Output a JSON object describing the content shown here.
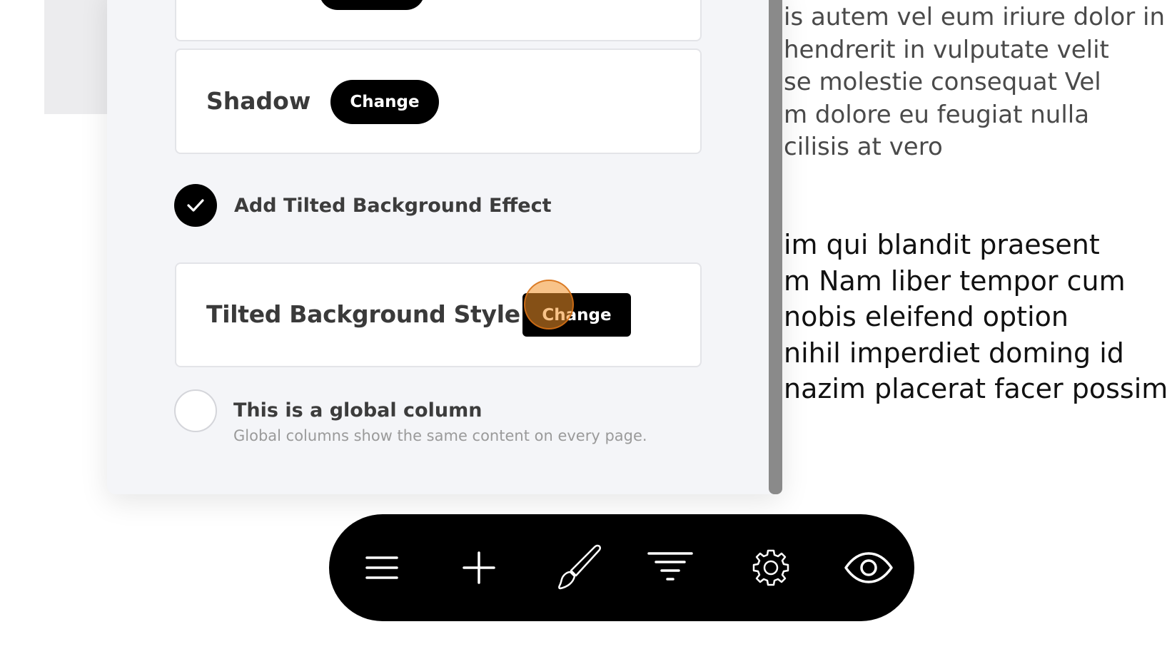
{
  "background_text": {
    "paragraph1": [
      "is autem vel eum iriure dolor in",
      "hendrerit in vulputate velit",
      "se molestie consequat Vel",
      "m dolore eu feugiat nulla",
      "cilisis at vero"
    ],
    "paragraph2": [
      "im qui blandit praesent",
      "m Nam liber tempor cum",
      "nobis eleifend option",
      "nihil imperdiet doming id",
      "nazim placerat facer possim"
    ]
  },
  "panel": {
    "top_card": {
      "button_label": ""
    },
    "shadow_card": {
      "label": "Shadow",
      "button_label": "Change"
    },
    "tilted_checkbox": {
      "label": "Add Tilted Background Effect",
      "checked": true
    },
    "tilted_style_card": {
      "label": "Tilted Background Style",
      "button_label": "Change"
    },
    "global_column": {
      "title": "This is a global column",
      "description": "Global columns show the same content on every page.",
      "checked": false
    }
  },
  "toolbar": {
    "items": [
      {
        "icon": "menu-icon"
      },
      {
        "icon": "plus-icon"
      },
      {
        "icon": "brush-icon"
      },
      {
        "icon": "filter-icon"
      },
      {
        "icon": "gear-icon"
      },
      {
        "icon": "eye-icon"
      }
    ]
  },
  "colors": {
    "panel_bg": "#f4f5f8",
    "button_bg": "#000000",
    "click_indicator": "#f29128"
  }
}
